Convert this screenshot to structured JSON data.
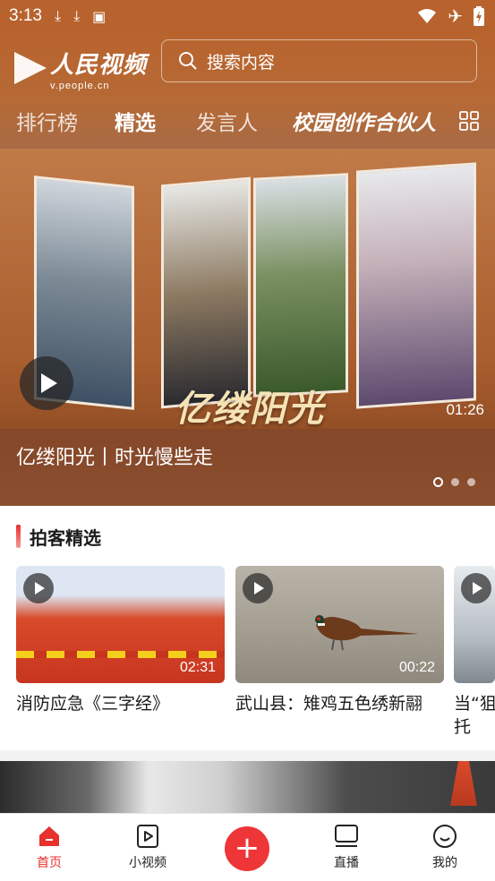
{
  "status_bar": {
    "time": "3:13"
  },
  "header": {
    "logo_title": "人民视频",
    "logo_sub": "v.people.cn",
    "search_placeholder": "搜索内容"
  },
  "tabs": [
    {
      "label": "排行榜",
      "active": false
    },
    {
      "label": "精选",
      "active": true
    },
    {
      "label": "发言人",
      "active": false
    },
    {
      "label": "校园创作合伙人",
      "active": false
    }
  ],
  "banner": {
    "overlay_title": "亿缕阳光",
    "duration": "01:26",
    "caption": "亿缕阳光丨时光慢些走",
    "page_count": 3,
    "current_page": 1
  },
  "section": {
    "title": "拍客精选",
    "cards": [
      {
        "title": "消防应急《三字经》",
        "duration": "02:31"
      },
      {
        "title": "武山县：雉鸡五色绣新翮",
        "duration": "00:22"
      },
      {
        "title": "当“狙托",
        "duration": ""
      }
    ]
  },
  "bottom_nav": [
    {
      "label": "首页",
      "icon": "home-icon",
      "active": true
    },
    {
      "label": "小视频",
      "icon": "short-video-icon",
      "active": false
    },
    {
      "label": "",
      "icon": "plus-icon",
      "active": false
    },
    {
      "label": "直播",
      "icon": "live-tv-icon",
      "active": false
    },
    {
      "label": "我的",
      "icon": "profile-smile-icon",
      "active": false
    }
  ],
  "colors": {
    "accent": "#e8302c",
    "header_bg": "#b8632e"
  }
}
